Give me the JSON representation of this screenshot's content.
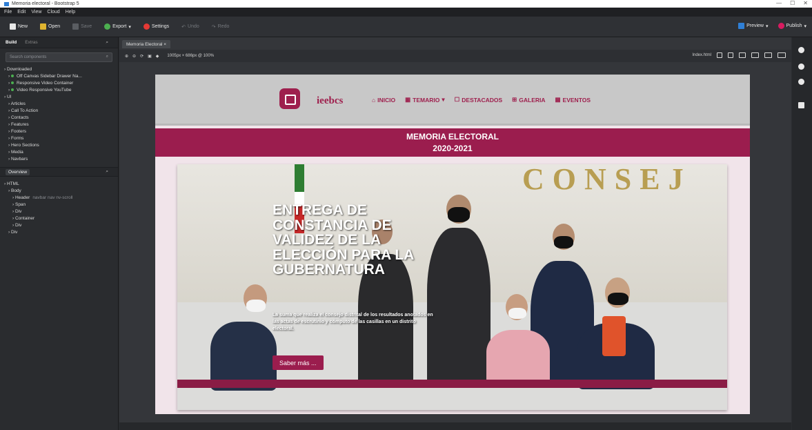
{
  "window": {
    "title": "Memoria electoral - Bootstrap 5"
  },
  "menu": [
    "File",
    "Edit",
    "View",
    "Cloud",
    "Help"
  ],
  "toolbar": {
    "new": "New",
    "open": "Open",
    "save": "Save",
    "export": "Export",
    "settings": "Settings",
    "undo": "Undo",
    "redo": "Redo",
    "preview": "Preview",
    "publish": "Publish"
  },
  "left_panel": {
    "tab_active": "Build",
    "tab_other": "Extras",
    "search_placeholder": "Search components",
    "tree": [
      {
        "label": "Downloaded",
        "level": 0
      },
      {
        "label": "Off Canvas Sidebar Drawer Na...",
        "level": 1,
        "dot": true
      },
      {
        "label": "Responsive Video Container",
        "level": 1,
        "dot": true
      },
      {
        "label": "Video Responsive YouTube",
        "level": 1,
        "dot": true
      },
      {
        "label": "UI",
        "level": 0
      },
      {
        "label": "Articles",
        "level": 1
      },
      {
        "label": "Call To Action",
        "level": 1
      },
      {
        "label": "Contacts",
        "level": 1
      },
      {
        "label": "Features",
        "level": 1
      },
      {
        "label": "Footers",
        "level": 1
      },
      {
        "label": "Forms",
        "level": 1
      },
      {
        "label": "Hero Sections",
        "level": 1
      },
      {
        "label": "Media",
        "level": 1
      },
      {
        "label": "Navbars",
        "level": 1
      }
    ],
    "overview_label": "Overview",
    "overview_tree": [
      {
        "label": "HTML",
        "level": 0
      },
      {
        "label": "Body",
        "level": 1
      },
      {
        "label": "Header",
        "level": 2,
        "extra": "navbar nav nv-scroll"
      },
      {
        "label": "Span",
        "level": 2
      },
      {
        "label": "Div",
        "level": 2
      },
      {
        "label": "Container",
        "level": 2
      },
      {
        "label": "Div",
        "level": 2
      },
      {
        "label": "Div",
        "level": 1
      }
    ]
  },
  "canvas": {
    "doc_tab": "Memoria Electoral",
    "zoom_label": "1005px × 686px @ 100%",
    "device_label": "Index.html"
  },
  "site": {
    "brand": "ieebcs",
    "nav": [
      "INICIO",
      "TEMARIO",
      "DESTACADOS",
      "GALERIA",
      "EVENTOS"
    ],
    "banner_line1": "MEMORIA ELECTORAL",
    "banner_line2": "2020-2021",
    "hero_word": "CONSEJ",
    "hero_title": "ENTREGA DE CONSTANCIA DE VALIDEZ DE LA ELECCIÓN PARA LA GUBERNATURA",
    "hero_sub": "La suma que realiza el consejo distrital de los resultados anotados en las actas de escrutinio y cómputo de las casillas en un distrito electoral.",
    "cta": "Saber más ..."
  }
}
